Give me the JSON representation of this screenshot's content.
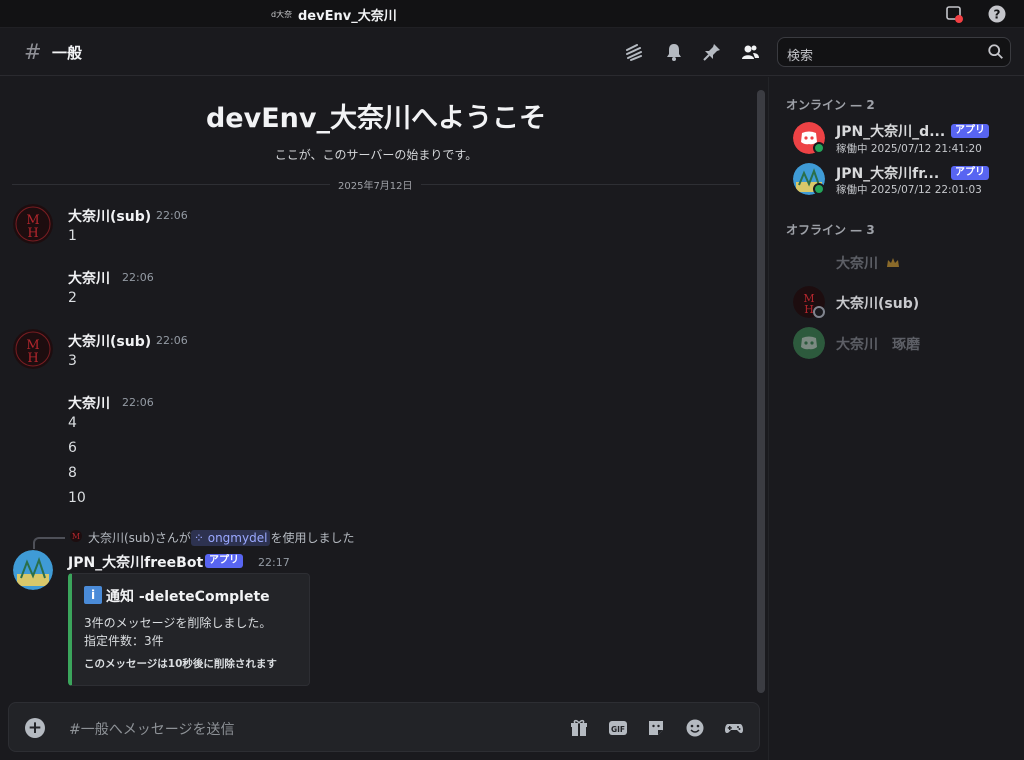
{
  "window": {
    "server_short": "d大奈",
    "title": "devEnv_大奈川"
  },
  "channel": {
    "name": "一般",
    "search_placeholder": "検索"
  },
  "welcome": {
    "title": "devEnv_大奈川へようこそ",
    "subtitle": "ここが、このサーバーの始まりです。"
  },
  "date_divider": "2025年7月12日",
  "messages": [
    {
      "author": "大奈川(sub)",
      "time": "22:06",
      "lines": [
        "1"
      ]
    },
    {
      "author": "大奈川",
      "time": "22:06",
      "lines": [
        "2"
      ]
    },
    {
      "author": "大奈川(sub)",
      "time": "22:06",
      "lines": [
        "3"
      ]
    },
    {
      "author": "大奈川",
      "time": "22:06",
      "lines": [
        "4",
        "6",
        "8",
        "10"
      ]
    }
  ],
  "command_reply": {
    "user": "大奈川(sub)",
    "prefix": "さんが",
    "command": "ongmydel",
    "suffix": "を使用しました"
  },
  "bot_message": {
    "author": "JPN_大奈川freeBot",
    "badge": "アプリ",
    "time": "22:17",
    "embed": {
      "title": "通知 -deleteComplete",
      "description": "3件のメッセージを削除しました。\n指定件数：3件",
      "footer": "このメッセージは10秒後に削除されます",
      "accent": "#3ba55c"
    }
  },
  "composer": {
    "placeholder": "#一般へメッセージを送信",
    "gif_label": "GIF"
  },
  "members": {
    "online_header": "オンライン — 2",
    "offline_header": "オフライン — 3",
    "online": [
      {
        "name": "JPN_大奈川_d...",
        "badge": "アプリ",
        "activity": "稼働中 2025/07/12 21:41:20",
        "status_color": "#23a55a"
      },
      {
        "name": "JPN_大奈川fr...",
        "badge": "アプリ",
        "activity": "稼働中 2025/07/12 22:01:03",
        "status_color": "#23a55a"
      }
    ],
    "offline": [
      {
        "name": "大奈川"
      },
      {
        "name": "大奈川(sub)"
      },
      {
        "name": "大奈川　琢磨"
      }
    ]
  },
  "colors": {
    "accent": "#5865f2",
    "online": "#23a55a",
    "offline": "#80848e"
  }
}
